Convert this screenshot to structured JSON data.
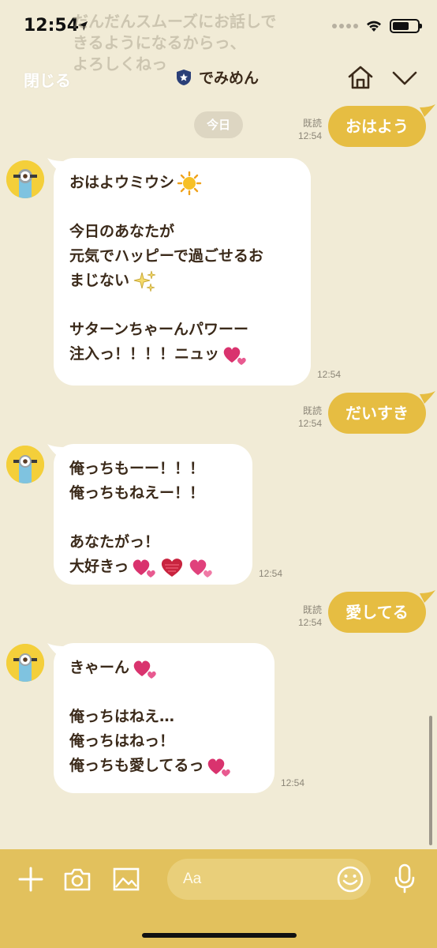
{
  "status_bar": {
    "time": "12:54"
  },
  "overlay_text": [
    "だんだんスムーズにお話しで",
    "きるようになるからっ、",
    "よろしくねっ"
  ],
  "header": {
    "close_label": "閉じる",
    "title": "でみめん"
  },
  "date_chip": "今日",
  "messages": {
    "m1": {
      "text": "おはよう",
      "read": "既読",
      "time": "12:54"
    },
    "m2": {
      "lines": [
        "おはよウミウシ",
        "",
        "今日のあなたが",
        "元気でハッピーで過ごせるお",
        "まじない",
        "",
        "サターンちゃーんパワーー",
        "注入っ！！！！ニュッ"
      ],
      "time": "12:54"
    },
    "m3": {
      "text": "だいすき",
      "read": "既読",
      "time": "12:54"
    },
    "m4": {
      "lines": [
        "俺っちもーー！！！",
        "俺っちもねえー！！",
        "",
        "あなたがっ！",
        "大好きっ"
      ],
      "time": "12:54"
    },
    "m5": {
      "text": "愛してる",
      "read": "既読",
      "time": "12:54"
    },
    "m6": {
      "lines": [
        "きゃーん",
        "",
        "俺っちはねえ…",
        "俺っちはねっ！",
        "俺っちも愛してるっ"
      ],
      "time": "12:54"
    }
  },
  "composer": {
    "placeholder": "Aa"
  },
  "icons": {
    "location": "location-arrow-icon",
    "wifi": "wifi-icon",
    "battery": "battery-icon",
    "home": "home-icon",
    "chevron": "chevron-down-icon",
    "plus": "plus-icon",
    "camera": "camera-icon",
    "image": "image-icon",
    "emoji": "smiley-icon",
    "mic": "microphone-icon"
  },
  "colors": {
    "background": "#f1ebd6",
    "outgoing_bubble": "#e6bd42",
    "incoming_bubble": "#ffffff",
    "bottom_bar": "#e2c15d"
  }
}
